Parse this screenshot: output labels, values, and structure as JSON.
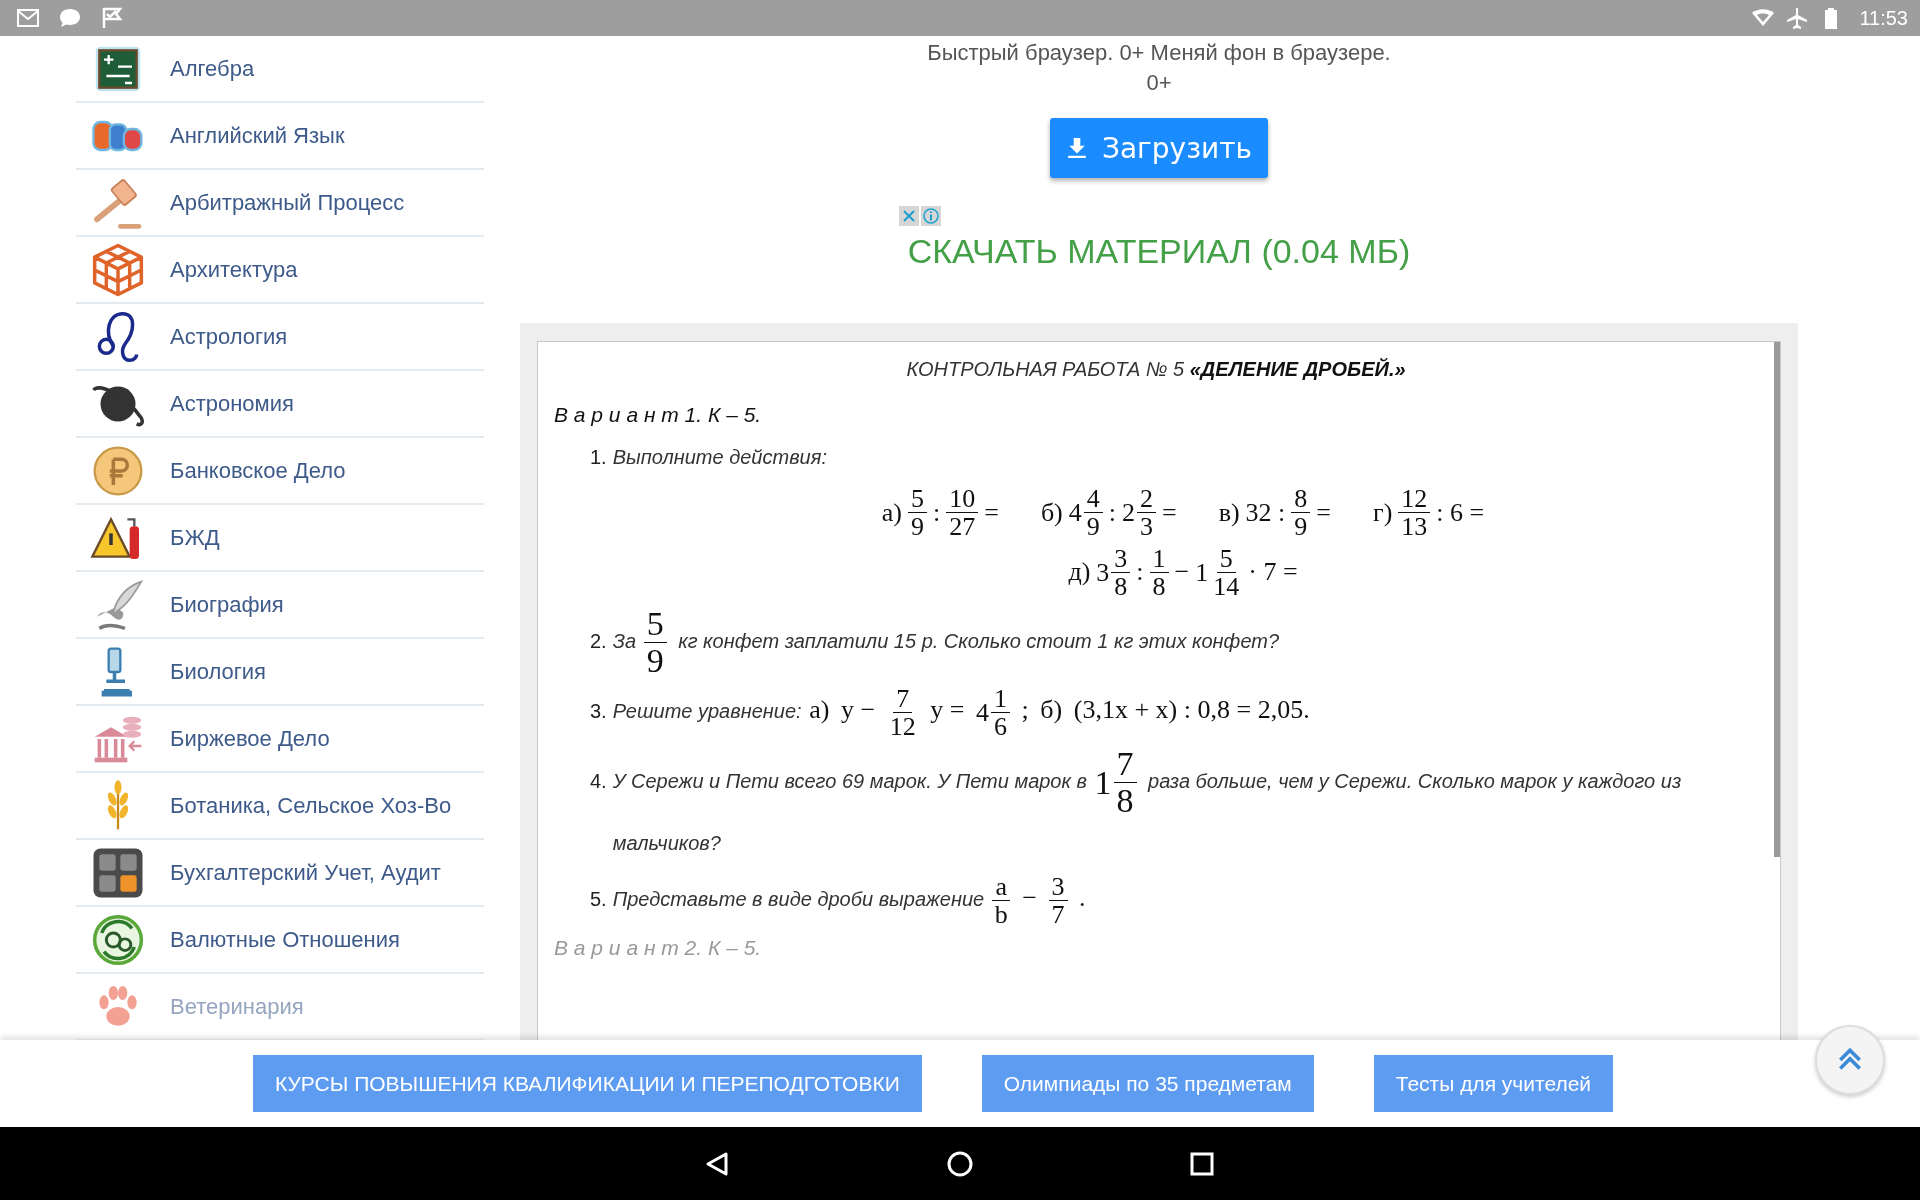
{
  "status_bar": {
    "time": "11:53"
  },
  "sidebar": {
    "items": [
      {
        "label": "Алгебра",
        "faded": false
      },
      {
        "label": "Английский Язык",
        "faded": false
      },
      {
        "label": "Арбитражный Процесс",
        "faded": false
      },
      {
        "label": "Архитектура",
        "faded": false
      },
      {
        "label": "Астрология",
        "faded": false
      },
      {
        "label": "Астрономия",
        "faded": false
      },
      {
        "label": "Банковское Дело",
        "faded": false
      },
      {
        "label": "БЖД",
        "faded": false
      },
      {
        "label": "Биография",
        "faded": false
      },
      {
        "label": "Биология",
        "faded": false
      },
      {
        "label": "Биржевое Дело",
        "faded": false
      },
      {
        "label": "Ботаника, Сельское Хоз-Во",
        "faded": false
      },
      {
        "label": "Бухгалтерский Учет, Аудит",
        "faded": false
      },
      {
        "label": "Валютные Отношения",
        "faded": false
      },
      {
        "label": "Ветеринария",
        "faded": true
      }
    ]
  },
  "promo": {
    "text": "Быстрый браузер. 0+ Меняй фон в браузере.",
    "rating": "0+",
    "button": "Загрузить"
  },
  "download_link": "СКАЧАТЬ МАТЕРИАЛ (0.04 МБ)",
  "document": {
    "title": "КОНТРОЛЬНАЯ РАБОТА № 5 **«ДЕЛЕНИЕ ДРОБЕЙ.»**",
    "variant": "В а р и а н т 1. К – 5.",
    "tasks": [
      {
        "number": "1.",
        "content": [
          {
            "kind": "text",
            "text": "Выполните действия:"
          }
        ],
        "math_lines": [
          [
            [
              {
                "kind": "sym",
                "text": "а)"
              },
              {
                "kind": "frac",
                "num": "5",
                "den": "9"
              },
              {
                "kind": "sym",
                "text": ":"
              },
              {
                "kind": "frac",
                "num": "10",
                "den": "27"
              },
              {
                "kind": "sym",
                "text": "="
              }
            ],
            [
              {
                "kind": "sym",
                "text": "б)"
              },
              {
                "kind": "frac",
                "whole": "4",
                "num": "4",
                "den": "9"
              },
              {
                "kind": "sym",
                "text": ":"
              },
              {
                "kind": "frac",
                "whole": "2",
                "num": "2",
                "den": "3"
              },
              {
                "kind": "sym",
                "text": "="
              }
            ],
            [
              {
                "kind": "sym",
                "text": "в)"
              },
              {
                "kind": "sym",
                "text": "32 :"
              },
              {
                "kind": "frac",
                "num": "8",
                "den": "9"
              },
              {
                "kind": "sym",
                "text": "="
              }
            ],
            [
              {
                "kind": "sym",
                "text": "г)"
              },
              {
                "kind": "frac",
                "num": "12",
                "den": "13"
              },
              {
                "kind": "sym",
                "text": ": 6 ="
              }
            ]
          ],
          [
            [
              {
                "kind": "sym",
                "text": "д)"
              },
              {
                "kind": "frac",
                "whole": "3",
                "num": "3",
                "den": "8"
              },
              {
                "kind": "sym",
                "text": ":"
              },
              {
                "kind": "frac",
                "num": "1",
                "den": "8"
              },
              {
                "kind": "sym",
                "text": "−"
              },
              {
                "kind": "frac",
                "whole": "1",
                "num": "5",
                "den": "14"
              },
              {
                "kind": "sym",
                "text": "· 7 ="
              }
            ]
          ]
        ]
      },
      {
        "number": "2.",
        "content": [
          {
            "kind": "text",
            "text": "За"
          },
          {
            "kind": "frac",
            "num": "5",
            "den": "9",
            "large": true
          },
          {
            "kind": "text",
            "text": "кг конфет заплатили 15 р. Сколько стоит 1 кг этих конфет?"
          }
        ]
      },
      {
        "number": "3.",
        "content": [
          {
            "kind": "text",
            "text": "Решите уравнение:"
          },
          {
            "kind": "sym",
            "text": "а)"
          },
          {
            "kind": "sym",
            "text": "y −"
          },
          {
            "kind": "frac",
            "num": "7",
            "den": "12"
          },
          {
            "kind": "sym",
            "text": "y ="
          },
          {
            "kind": "frac",
            "whole": "4",
            "num": "1",
            "den": "6"
          },
          {
            "kind": "sym",
            "text": ";"
          },
          {
            "kind": "sym",
            "text": "б)"
          },
          {
            "kind": "sym",
            "text": "(3,1x + x) : 0,8 = 2,05."
          }
        ]
      },
      {
        "number": "4.",
        "content": [
          {
            "kind": "text",
            "text": "У Сережи и Пети всего 69 марок. У Пети марок в"
          },
          {
            "kind": "frac",
            "whole": "1",
            "num": "7",
            "den": "8",
            "large": true
          },
          {
            "kind": "text",
            "text": "раза больше, чем у Сережи. Сколько марок у каждого из"
          },
          {
            "kind": "text",
            "text": "мальчиков?"
          }
        ]
      },
      {
        "number": "5.",
        "content": [
          {
            "kind": "text",
            "text": "Представьте в виде дроби выражение"
          },
          {
            "kind": "frac",
            "num": "a",
            "den": "b"
          },
          {
            "kind": "sym",
            "text": "−"
          },
          {
            "kind": "frac",
            "num": "3",
            "den": "7"
          },
          {
            "kind": "sym",
            "text": "."
          }
        ]
      }
    ],
    "next_variant": "В а р и а н т 2. К – 5."
  },
  "bottom_bar": {
    "buttons": [
      "КУРСЫ ПОВЫШЕНИЯ КВАЛИФИКАЦИИ И ПЕРЕПОДГОТОВКИ",
      "Олимпиады по 35 предметам",
      "Тесты для учителей"
    ]
  }
}
